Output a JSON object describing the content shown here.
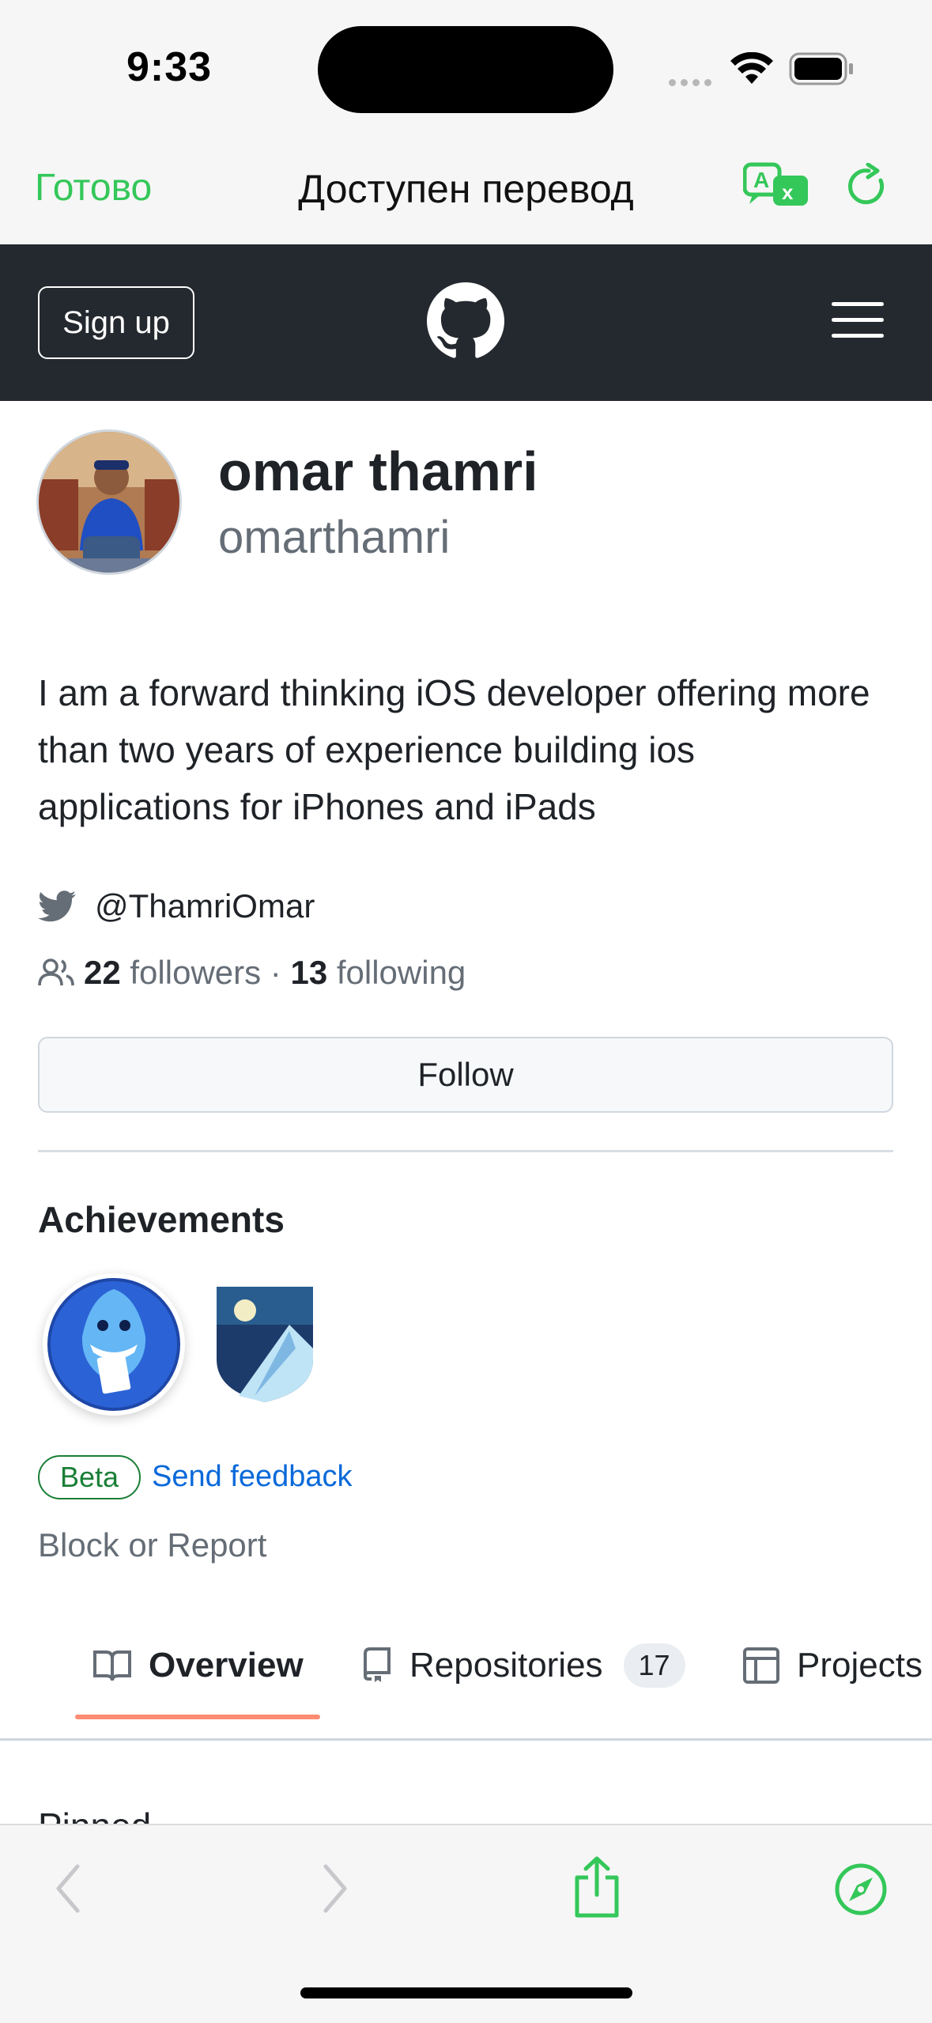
{
  "status_bar": {
    "time": "9:33"
  },
  "translate_bar": {
    "done_label": "Готово",
    "title": "Доступен перевод"
  },
  "github_header": {
    "signup_label": "Sign up"
  },
  "profile": {
    "name": "omar thamri",
    "login": "omarthamri",
    "bio": "I am a forward thinking iOS developer offering more than two years of experience building ios applications for iPhones and iPads",
    "twitter": "@ThamriOmar",
    "followers_count": "22",
    "followers_label": "followers",
    "separator": "·",
    "following_count": "13",
    "following_label": "following",
    "follow_button": "Follow"
  },
  "achievements": {
    "title": "Achievements",
    "badges": [
      "pull-shark-badge",
      "arctic-code-vault-badge"
    ],
    "beta_label": "Beta",
    "feedback_label": "Send feedback"
  },
  "block_report": "Block or Report",
  "tabs": [
    {
      "label": "Overview",
      "icon": "book-icon",
      "selected": true
    },
    {
      "label": "Repositories",
      "icon": "repo-icon",
      "count": "17"
    },
    {
      "label": "Projects",
      "icon": "table-icon"
    }
  ],
  "pinned_label": "Pinned",
  "colors": {
    "safari_accent": "#34c759",
    "github_dark": "#24292f",
    "link": "#0969da",
    "beta_green": "#1a7f37",
    "tab_underline": "#fd8c73"
  }
}
